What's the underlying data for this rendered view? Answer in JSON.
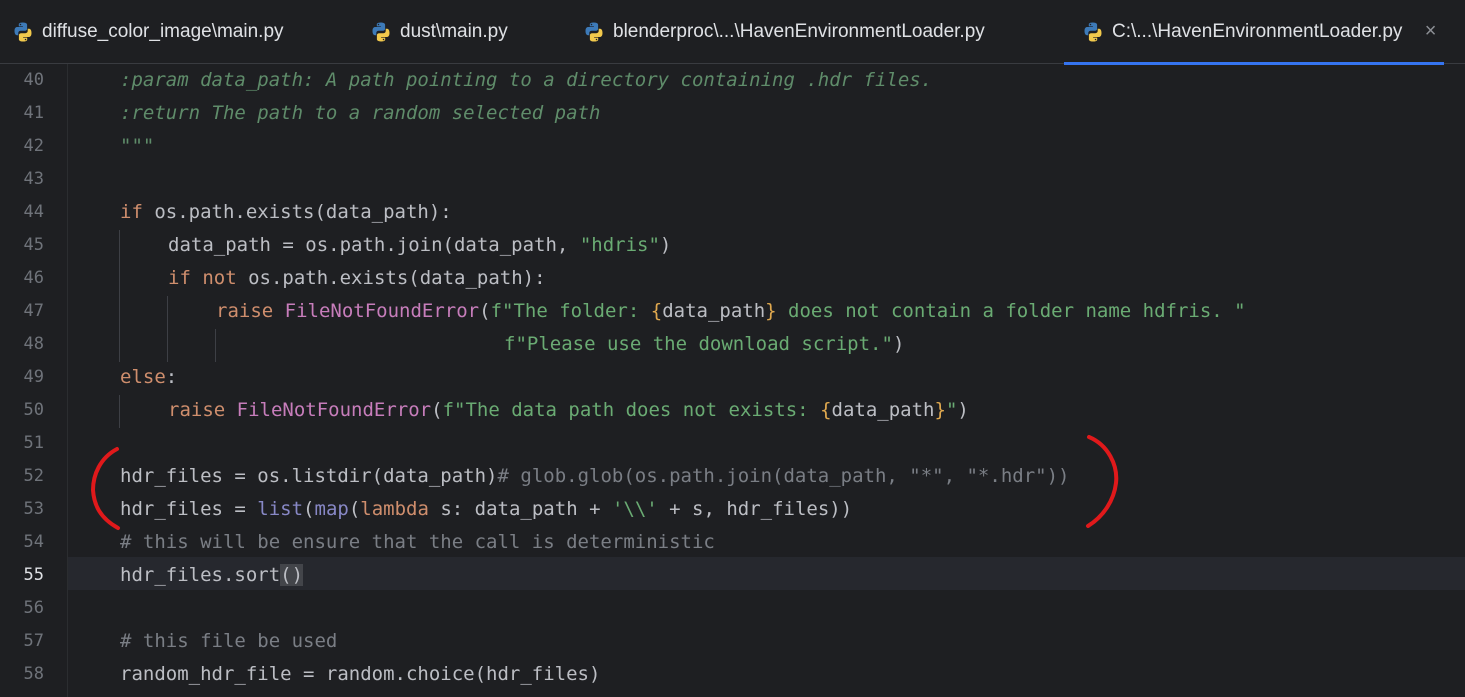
{
  "tabs": [
    {
      "label": "diffuse_color_image\\main.py"
    },
    {
      "label": "dust\\main.py"
    },
    {
      "label": "blenderproc\\...\\HavenEnvironmentLoader.py"
    },
    {
      "label": "C:\\...\\HavenEnvironmentLoader.py",
      "close": "×"
    }
  ],
  "editor": {
    "line_numbers": [
      "40",
      "41",
      "42",
      "43",
      "44",
      "45",
      "46",
      "47",
      "48",
      "49",
      "50",
      "51",
      "52",
      "53",
      "54",
      "55",
      "56",
      "57",
      "58"
    ],
    "current_line": "55",
    "tokens": {
      "l40": ":param data_path: A path pointing to a directory containing .hdr files.",
      "l41": ":return The path to a random selected path",
      "l42": "\"\"\"",
      "l44_kw": "if",
      "l44_rest": " os.path.exists(data_path):",
      "l45_a": "data_path = os.path.join(data_path, ",
      "l45_str": "\"hdris\"",
      "l45_b": ")",
      "l46_kw1": "if",
      "l46_sp": " ",
      "l46_kw2": "not",
      "l46_rest": " os.path.exists(data_path):",
      "l47_kw": "raise",
      "l47_sp": " ",
      "l47_cls": "FileNotFoundError",
      "l47_p": "(",
      "l47_s1": "f\"The folder: ",
      "l47_b1": "{",
      "l47_var": "data_path",
      "l47_b2": "}",
      "l47_s2": " does not contain a folder name hdfris. \"",
      "l48_s": "f\"Please use the download script.\"",
      "l48_p": ")",
      "l49_kw": "else",
      "l49_c": ":",
      "l50_kw": "raise",
      "l50_sp": " ",
      "l50_cls": "FileNotFoundError",
      "l50_p": "(",
      "l50_s1": "f\"The data path does not exists: ",
      "l50_b1": "{",
      "l50_var": "data_path",
      "l50_b2": "}",
      "l50_s2": "\"",
      "l50_e": ")",
      "l52_a": "hdr_files = os.listdir(data_path)",
      "l52_cm": "# glob.glob(os.path.join(data_path, \"*\", \"*.hdr\"))",
      "l53_a": "hdr_files = ",
      "l53_list": "list",
      "l53_p1": "(",
      "l53_map": "map",
      "l53_p2": "(",
      "l53_lam": "lambda",
      "l53_b": " s: data_path + ",
      "l53_str": "'\\\\'",
      "l53_c": " + s, hdr_files))",
      "l54_cm": "# this will be ensure that the call is deterministic",
      "l55_a": "hdr_files.sort",
      "l55_paren": "()",
      "l57_cm": "# this file be used",
      "l58_a": "random_hdr_file = random.choice(hdr_files)"
    }
  },
  "colors": {
    "background": "#1e1f22",
    "keyword": "#cf8e6d",
    "string": "#6aab73",
    "docstring": "#5f8c6a",
    "comment": "#7a7e85",
    "annotation_marker": "#e0191b",
    "tab_active_underline": "#3574f0"
  }
}
